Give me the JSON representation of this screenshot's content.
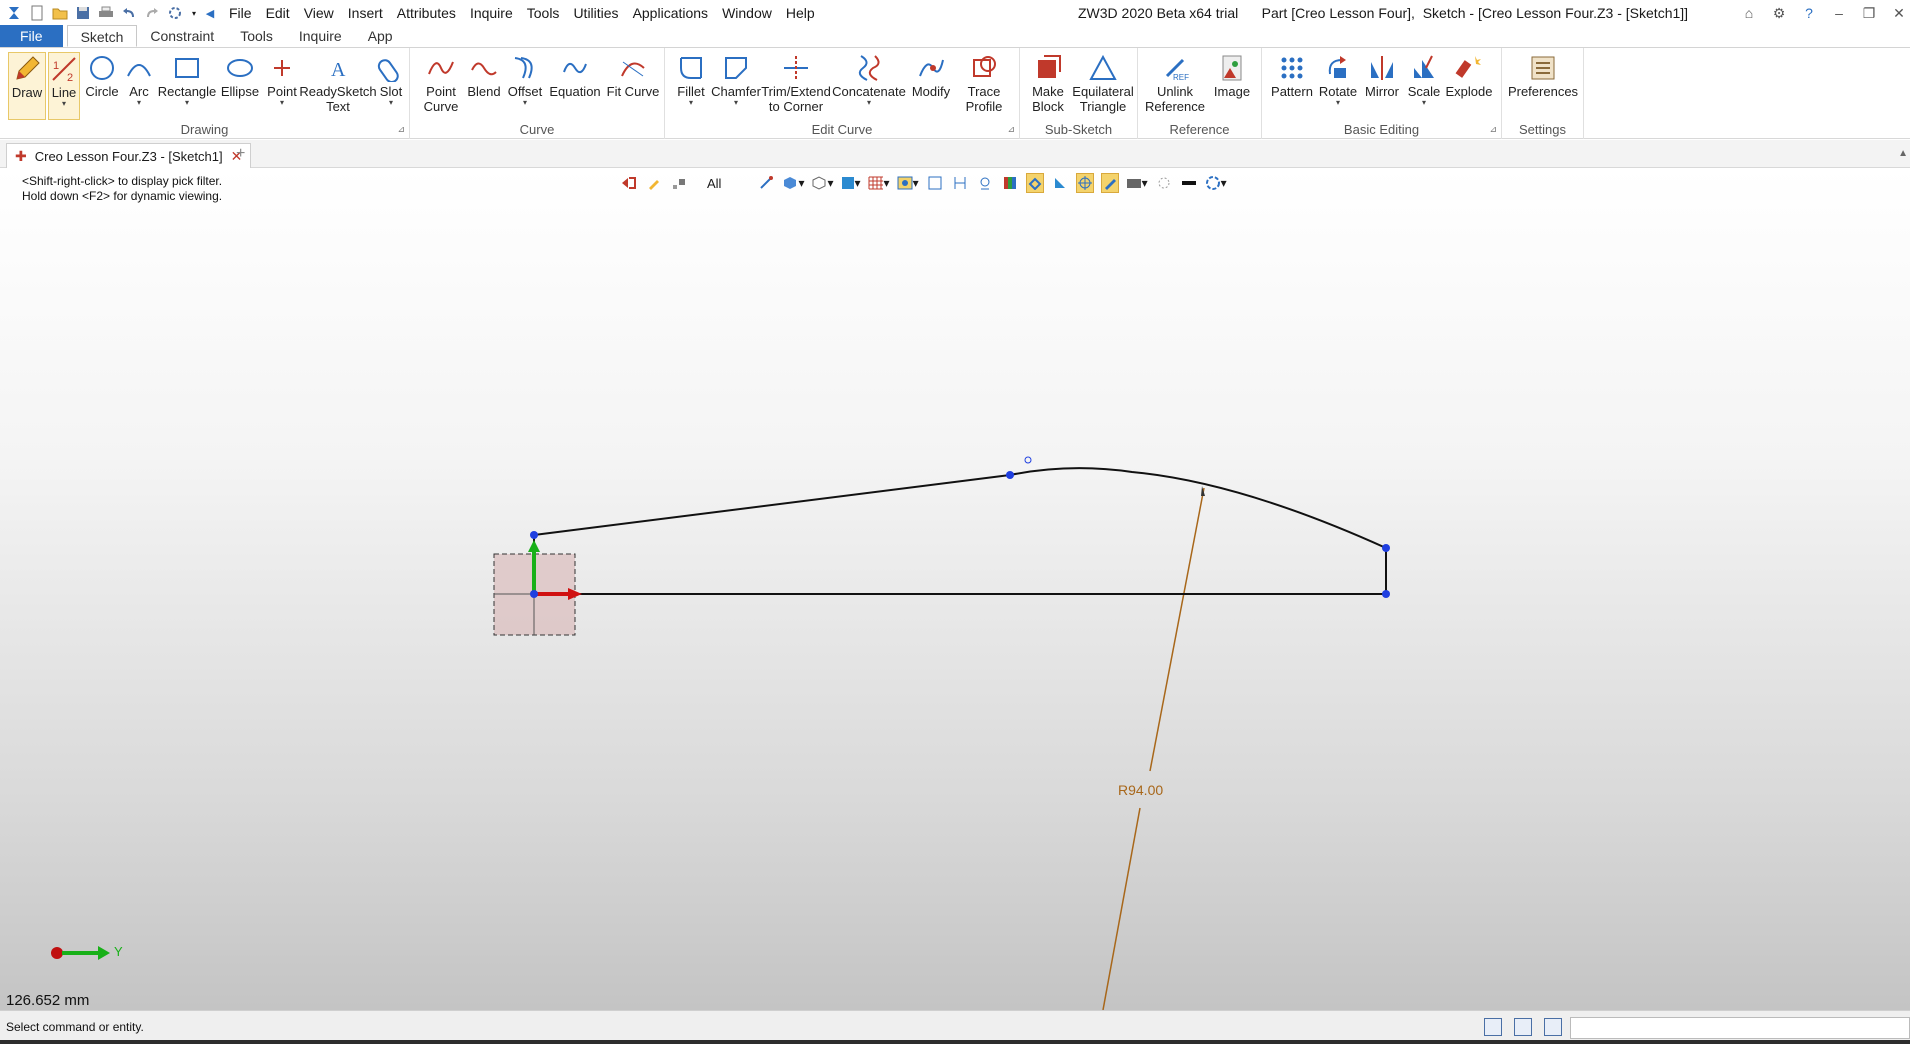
{
  "titlebar": {
    "menu": [
      "File",
      "Edit",
      "View",
      "Insert",
      "Attributes",
      "Inquire",
      "Tools",
      "Utilities",
      "Applications",
      "Window",
      "Help"
    ],
    "title": "ZW3D 2020 Beta x64 trial      Part [Creo Lesson Four],  Sketch - [Creo Lesson Four.Z3 - [Sketch1]]"
  },
  "ribbon_tabs": [
    "File",
    "Sketch",
    "Constraint",
    "Tools",
    "Inquire",
    "App"
  ],
  "ribbon": {
    "groups": {
      "drawing": "Drawing",
      "curve": "Curve",
      "edit_curve": "Edit Curve",
      "sub_sketch": "Sub-Sketch",
      "reference": "Reference",
      "basic_editing": "Basic Editing",
      "settings": "Settings"
    },
    "buttons": {
      "draw": "Draw",
      "line": "Line",
      "circle": "Circle",
      "arc": "Arc",
      "rectangle": "Rectangle",
      "ellipse": "Ellipse",
      "point": "Point",
      "readysketch_text_1": "ReadySketch",
      "readysketch_text_2": "Text",
      "slot": "Slot",
      "point_curve_1": "Point",
      "point_curve_2": "Curve",
      "blend": "Blend",
      "offset": "Offset",
      "equation": "Equation",
      "fit_curve": "Fit Curve",
      "fillet": "Fillet",
      "chamfer": "Chamfer",
      "trim_1": "Trim/Extend",
      "trim_2": "to Corner",
      "concatenate": "Concatenate",
      "modify": "Modify",
      "trace_profile_1": "Trace",
      "trace_profile_2": "Profile",
      "make_block_1": "Make",
      "make_block_2": "Block",
      "eq_triangle_1": "Equilateral",
      "eq_triangle_2": "Triangle",
      "unlink_ref_1": "Unlink",
      "unlink_ref_2": "Reference",
      "image": "Image",
      "pattern": "Pattern",
      "rotate": "Rotate",
      "mirror": "Mirror",
      "scale": "Scale",
      "explode": "Explode",
      "preferences": "Preferences"
    }
  },
  "document_tab": {
    "label": "Creo Lesson Four.Z3 - [Sketch1]"
  },
  "viewport": {
    "hint_1": "<Shift-right-click> to display pick filter.",
    "hint_2": "Hold down <F2> for dynamic viewing.",
    "filter_value": "All",
    "dimension_label": "R94.00",
    "triad_axis": "Y",
    "measure": "126.652 mm"
  },
  "status": {
    "text": "Select command or entity."
  },
  "colors": {
    "file_tab": "#2b6fc2",
    "sketch_line": "#111111",
    "vertex": "#1f3fe0",
    "dimension": "#a8671a",
    "axis_x": "#d01010",
    "axis_y": "#18b018"
  }
}
